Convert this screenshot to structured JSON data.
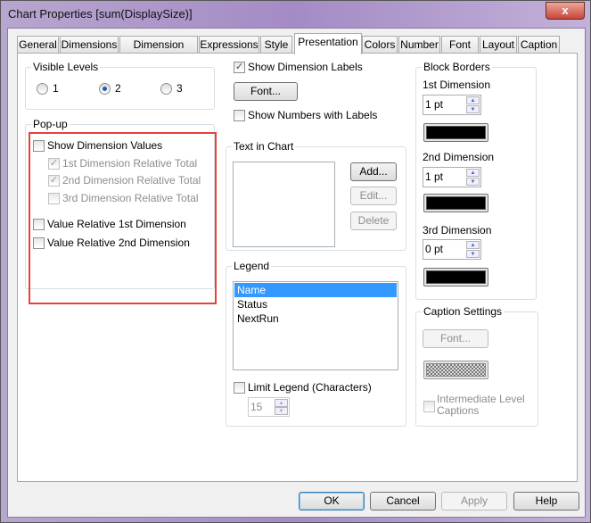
{
  "window": {
    "title": "Chart Properties [sum(DisplaySize)]",
    "close": "x"
  },
  "tabs": [
    "General",
    "Dimensions",
    "Dimension Limits",
    "Expressions",
    "Style",
    "Presentation",
    "Colors",
    "Number",
    "Font",
    "Layout",
    "Caption"
  ],
  "active_tab": "Presentation",
  "visible_levels": {
    "label": "Visible Levels",
    "options": [
      "1",
      "2",
      "3"
    ],
    "selected": "2"
  },
  "popup": {
    "label": "Pop-up",
    "show_dimension_values": "Show Dimension Values",
    "rel1": "1st Dimension Relative Total",
    "rel2": "2nd Dimension Relative Total",
    "rel3": "3rd Dimension Relative Total",
    "value_rel1": "Value Relative 1st Dimension",
    "value_rel2": "Value Relative 2nd Dimension"
  },
  "labels": {
    "show_dimension_labels": "Show Dimension Labels",
    "font_button": "Font...",
    "show_numbers": "Show Numbers with Labels"
  },
  "text_in_chart": {
    "label": "Text in Chart",
    "add": "Add...",
    "edit": "Edit...",
    "delete": "Delete"
  },
  "legend": {
    "label": "Legend",
    "items": [
      "Name",
      "Status",
      "NextRun"
    ],
    "selected": "Name",
    "limit_label": "Limit Legend (Characters)",
    "limit_value": "15"
  },
  "block_borders": {
    "label": "Block Borders",
    "dim1_label": "1st Dimension",
    "dim1_value": "1 pt",
    "dim2_label": "2nd Dimension",
    "dim2_value": "1 pt",
    "dim3_label": "3rd Dimension",
    "dim3_value": "0 pt",
    "color": "#000000"
  },
  "caption_settings": {
    "label": "Caption Settings",
    "font_button": "Font...",
    "intermediate": "Intermediate Level Captions"
  },
  "footer": {
    "ok": "OK",
    "cancel": "Cancel",
    "apply": "Apply",
    "help": "Help"
  },
  "highlight_color": "#e5423a"
}
